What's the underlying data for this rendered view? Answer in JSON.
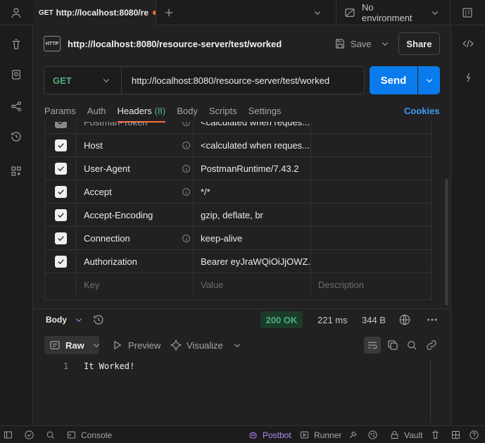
{
  "topbar": {
    "tab": {
      "method": "GET",
      "title": "http://localhost:8080/re"
    },
    "environment": "No environment"
  },
  "request": {
    "title": "http://localhost:8080/resource-server/test/worked",
    "save_label": "Save",
    "share_label": "Share",
    "method": "GET",
    "url": "http://localhost:8080/resource-server/test/worked",
    "send_label": "Send",
    "tabs": {
      "params": "Params",
      "auth": "Auth",
      "headers": "Headers",
      "headers_count": "(8)",
      "body": "Body",
      "scripts": "Scripts",
      "settings": "Settings"
    },
    "cookies_label": "Cookies",
    "headers": [
      {
        "key": "Postman-Token",
        "value": "<calculated when reques..."
      },
      {
        "key": "Host",
        "value": "<calculated when reques..."
      },
      {
        "key": "User-Agent",
        "value": "PostmanRuntime/7.43.2"
      },
      {
        "key": "Accept",
        "value": "*/*"
      },
      {
        "key": "Accept-Encoding",
        "value": "gzip, deflate, br"
      },
      {
        "key": "Connection",
        "value": "keep-alive"
      },
      {
        "key": "Authorization",
        "value": "Bearer eyJraWQiOiJjOWZ..."
      }
    ],
    "placeholder": {
      "key": "Key",
      "value": "Value",
      "description": "Description"
    }
  },
  "response": {
    "body_label": "Body",
    "status": "200 OK",
    "time": "221 ms",
    "size": "344 B",
    "format": "Raw",
    "preview_label": "Preview",
    "visualize_label": "Visualize",
    "line_number": "1",
    "content": "It Worked!"
  },
  "statusbar": {
    "console": "Console",
    "postbot": "Postbot",
    "runner": "Runner",
    "vault": "Vault"
  },
  "colors": {
    "accent": "#ff6c37",
    "send": "#097bed",
    "success": "#4caf7d",
    "link": "#3d9bf2",
    "postbot": "#b38cf5"
  }
}
